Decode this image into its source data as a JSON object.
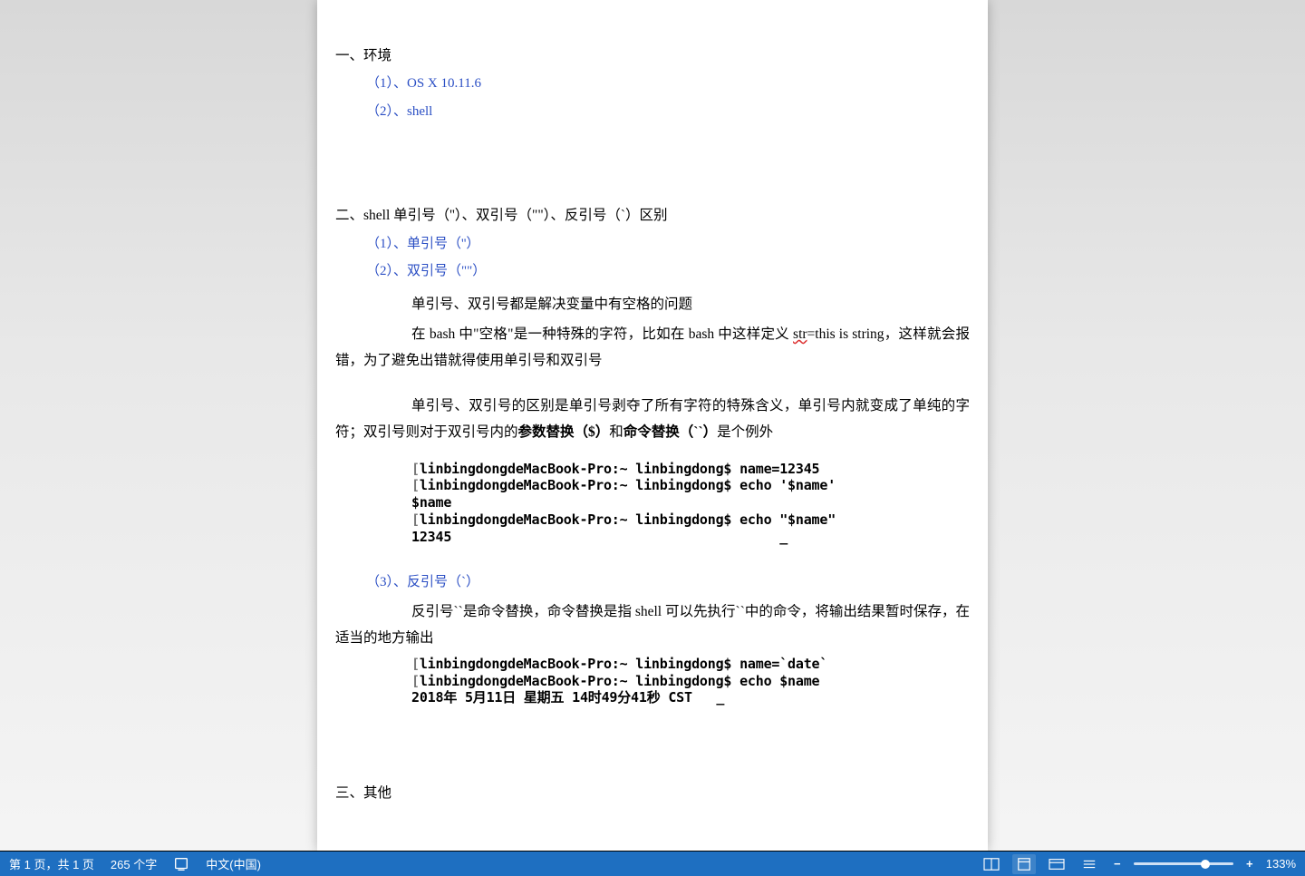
{
  "doc": {
    "section1": {
      "title": "一、环境",
      "item1": "（1）、OS X 10.11.6",
      "item2": "（2）、shell"
    },
    "section2": {
      "title": "二、shell 单引号（''）、双引号（\"\"）、反引号（`）区别",
      "item1": "（1）、单引号（''）",
      "item2": "（2）、双引号（\"\"）",
      "para1_pre": "单引号、双引号都是解决变量中有空格的问题",
      "para2_a": "在 bash 中\"空格\"是一种特殊的字符，比如在 bash 中这样定义 ",
      "para2_err": "str",
      "para2_b": "=this is string，这样就会报错，为了避免出错就得使用单引号和双引号",
      "para3_a": "单引号、双引号的区别是单引号剥夺了所有字符的特殊含义，单引号内就变成了单纯的字符；双引号则对于双引号内的",
      "para3_bold1": "参数替换（$）",
      "para3_mid": "和",
      "para3_bold2": "命令替换（``）",
      "para3_tail": "是个例外",
      "code1_l1": "linbingdongdeMacBook-Pro:~ linbingdong$ name=12345",
      "code1_l2": "linbingdongdeMacBook-Pro:~ linbingdong$ echo '$name'",
      "code1_l3": "$name",
      "code1_l4": "linbingdongdeMacBook-Pro:~ linbingdong$ echo \"$name\"",
      "code1_l5": "12345",
      "item3": "（3）、反引号（`）",
      "para4": "反引号``是命令替换，命令替换是指 shell 可以先执行``中的命令，将输出结果暂时保存，在适当的地方输出",
      "code2_l1": "linbingdongdeMacBook-Pro:~ linbingdong$ name=`date`",
      "code2_l2": "linbingdongdeMacBook-Pro:~ linbingdong$ echo $name",
      "code2_l3": "2018年 5月11日 星期五 14时49分41秒 CST"
    },
    "section3": {
      "title": "三、其他"
    }
  },
  "statusbar": {
    "page_info": "第 1 页，共 1 页",
    "word_count": "265 个字",
    "language": "中文(中国)",
    "zoom": "133%"
  }
}
